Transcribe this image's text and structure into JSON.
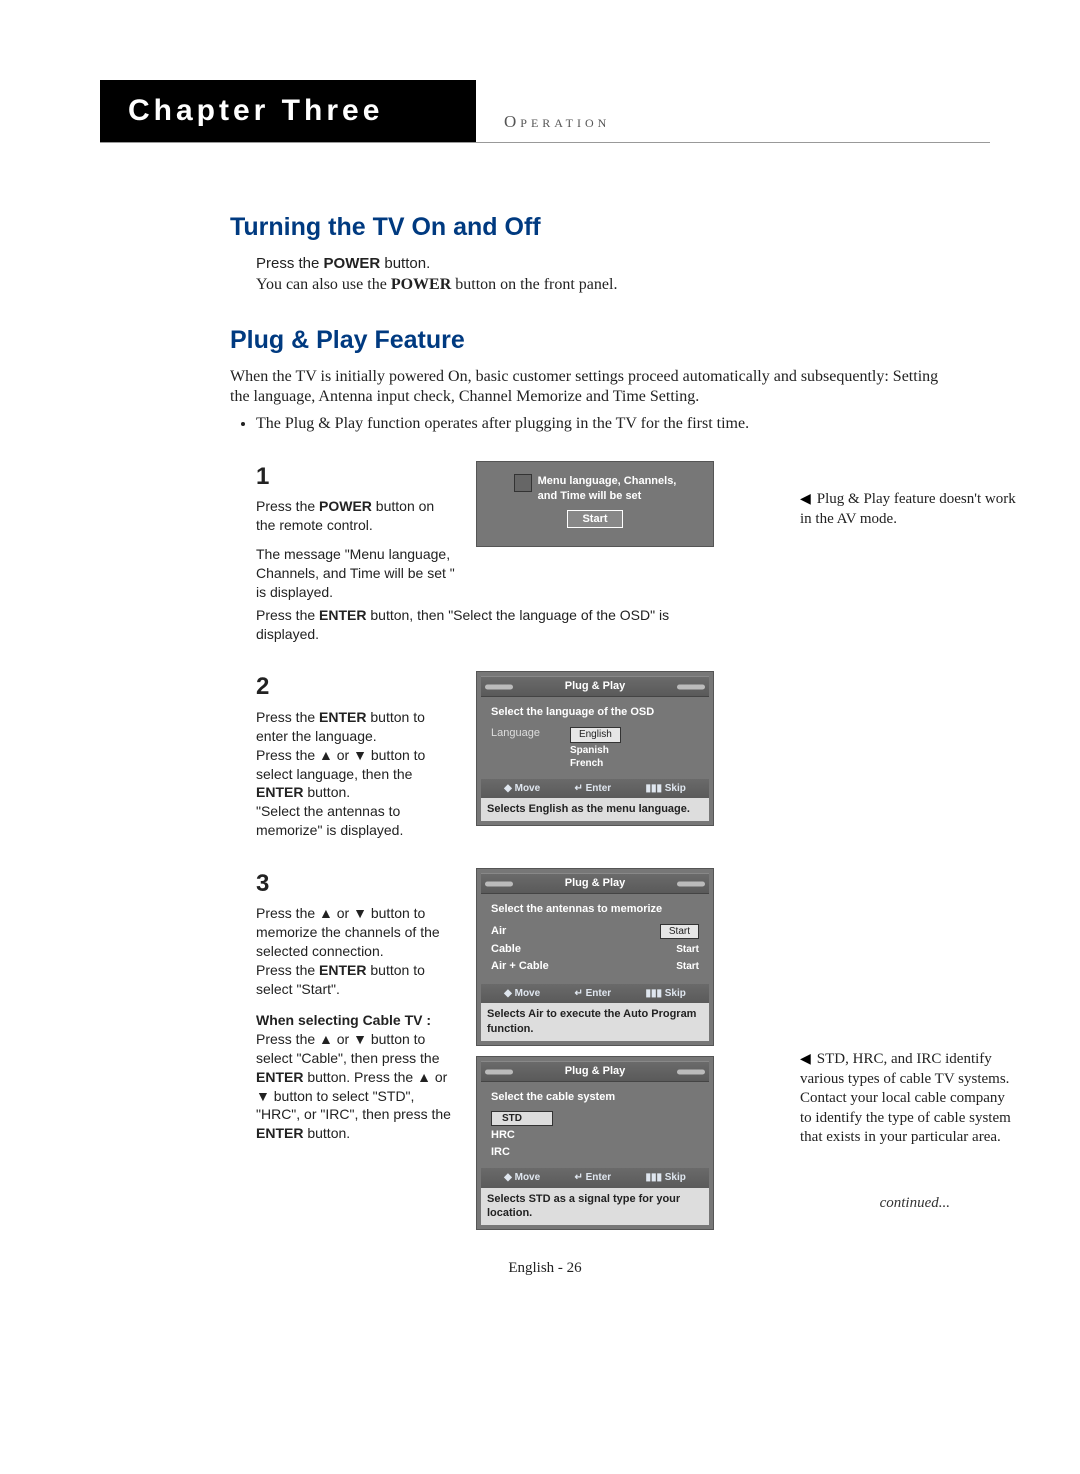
{
  "chapter": {
    "title": "Chapter Three",
    "subtitle": "Operation"
  },
  "section1": {
    "heading": "Turning the TV On and Off",
    "line1a": "Press the ",
    "line1b": "POWER",
    "line1c": " button.",
    "line2a": "You can also use the ",
    "line2b": "POWER",
    "line2c": " button on the front panel."
  },
  "section2": {
    "heading": "Plug & Play Feature",
    "intro": "When the TV is initially powered On, basic customer settings proceed automatically and subsequently: Setting the language, Antenna input check, Channel Memorize and Time Setting.",
    "bullet1": "The Plug & Play function operates after plugging in the TV for the first time."
  },
  "sidenote1": "Plug & Play feature doesn't work in the AV mode.",
  "sidenote2": "STD, HRC, and IRC identify various types of cable TV systems. Contact your local cable company to identify the type of cable system that exists in your particular area.",
  "continued": "continued...",
  "step1": {
    "num": "1",
    "t1": "Press the ",
    "t1b": "POWER",
    "t1c": " button on the remote control.",
    "t2": "The message \"Menu language, Channels, and Time will be set \" is displayed.",
    "t3a": "Press the ",
    "t3b": "ENTER",
    "t3c": " button, then \"Select the language of the OSD\" is displayed.",
    "osd": {
      "msg1": "Menu language, Channels,",
      "msg2": "and Time will be set",
      "start": "Start"
    }
  },
  "step2": {
    "num": "2",
    "t1a": "Press the ",
    "t1b": "ENTER",
    "t1c": " button to enter the language.",
    "t2": "Press the ▲ or ▼ button to select language, then the ",
    "t2b": "ENTER",
    "t2c": " button.",
    "t3": "\"Select the antennas to memorize\" is displayed.",
    "osd": {
      "bar": "Plug & Play",
      "title": "Select the language of the OSD",
      "label": "Language",
      "opts": [
        "English",
        "Spanish",
        "French"
      ],
      "foot_move": "Move",
      "foot_enter": "Enter",
      "foot_skip": "Skip",
      "caption": "Selects English as the menu language."
    }
  },
  "step3": {
    "num": "3",
    "t1": "Press the ▲ or ▼ button to memorize the channels of the selected connection.",
    "t2a": "Press the ",
    "t2b": "ENTER",
    "t2c": " button to select \"Start\".",
    "sub_head": "When selecting Cable TV :",
    "sub": "Press the ▲ or ▼ button to select \"Cable\", then press the ",
    "subb": "ENTER",
    "subc": " button. Press the ▲ or ▼ button to select \"STD\", \"HRC\", or \"IRC\", then press the ",
    "subd": "ENTER",
    "sube": " button.",
    "osd1": {
      "bar": "Plug & Play",
      "title": "Select the antennas to memorize",
      "rows": [
        [
          "Air",
          "Start"
        ],
        [
          "Cable",
          "Start"
        ],
        [
          "Air + Cable",
          "Start"
        ]
      ],
      "foot_move": "Move",
      "foot_enter": "Enter",
      "foot_skip": "Skip",
      "caption": "Selects Air to execute the Auto Program function."
    },
    "osd2": {
      "bar": "Plug & Play",
      "title": "Select the cable system",
      "rows": [
        "STD",
        "HRC",
        "IRC"
      ],
      "foot_move": "Move",
      "foot_enter": "Enter",
      "foot_skip": "Skip",
      "caption": "Selects STD as a signal type for your location."
    }
  },
  "footer": "English - 26",
  "glyph": {
    "updown": "◆",
    "enter": "↵",
    "skip": "▮▮▮",
    "tri": "◀"
  }
}
